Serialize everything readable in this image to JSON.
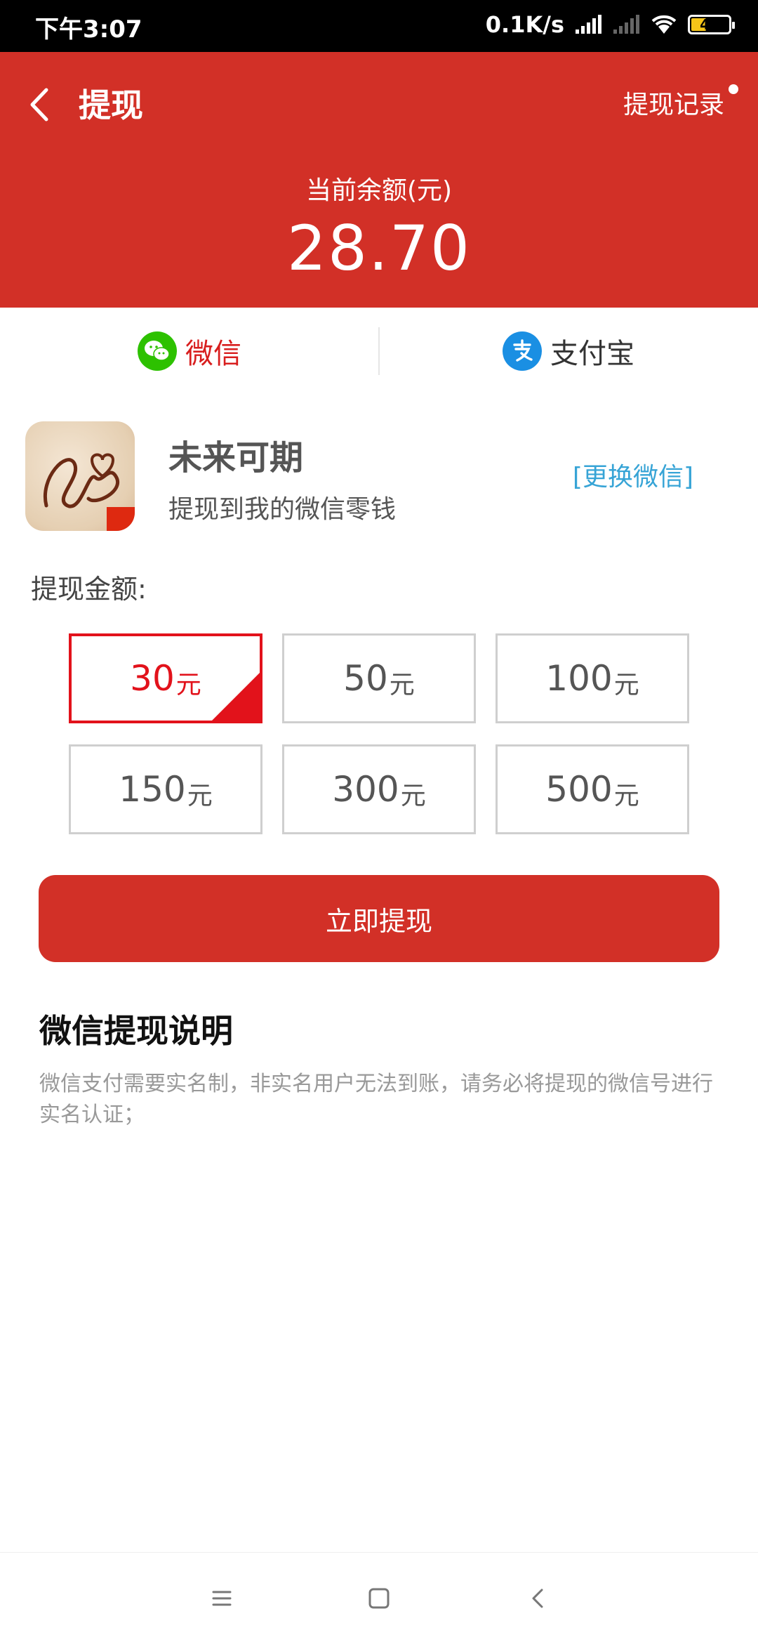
{
  "status_bar": {
    "time": "下午3:07",
    "net_speed": "0.1K/s",
    "battery": "40"
  },
  "header": {
    "title": "提现",
    "record_link": "提现记录",
    "balance_label": "当前余额(元)",
    "balance_value": "28.70"
  },
  "tabs": {
    "wechat": "微信",
    "alipay": "支付宝"
  },
  "account": {
    "name": "未来可期",
    "desc": "提现到我的微信零钱",
    "change_link": "[更换微信]"
  },
  "amount_section": {
    "title": "提现金额:",
    "options": [
      {
        "num": "30",
        "unit": "元",
        "selected": true
      },
      {
        "num": "50",
        "unit": "元",
        "selected": false
      },
      {
        "num": "100",
        "unit": "元",
        "selected": false
      },
      {
        "num": "150",
        "unit": "元",
        "selected": false
      },
      {
        "num": "300",
        "unit": "元",
        "selected": false
      },
      {
        "num": "500",
        "unit": "元",
        "selected": false
      }
    ]
  },
  "withdraw_button": "立即提现",
  "notes": {
    "title": "微信提现说明",
    "text": "微信支付需要实名制，非实名用户无法到账，请务必将提现的微信号进行实名认证；"
  },
  "colors": {
    "brand_red": "#d23027",
    "selected_red": "#e2121b",
    "link_blue": "#37a4d6",
    "wechat_green": "#2dc100",
    "alipay_blue": "#1a8fe3"
  }
}
